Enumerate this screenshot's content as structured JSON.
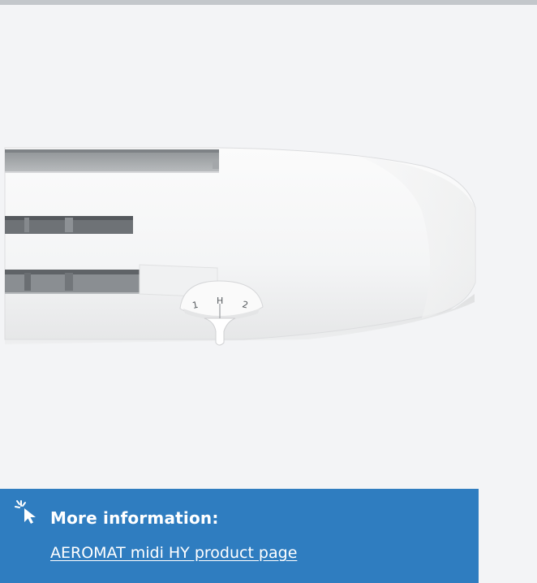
{
  "product_figure": {
    "dial_labels": [
      "1",
      "H",
      "2"
    ],
    "icon": "window-ventilator-image"
  },
  "info_box": {
    "icon": "cursor-click-icon",
    "heading": "More information:",
    "link_text": "AEROMAT midi HY product page",
    "background_color": "#2f7dc0"
  }
}
